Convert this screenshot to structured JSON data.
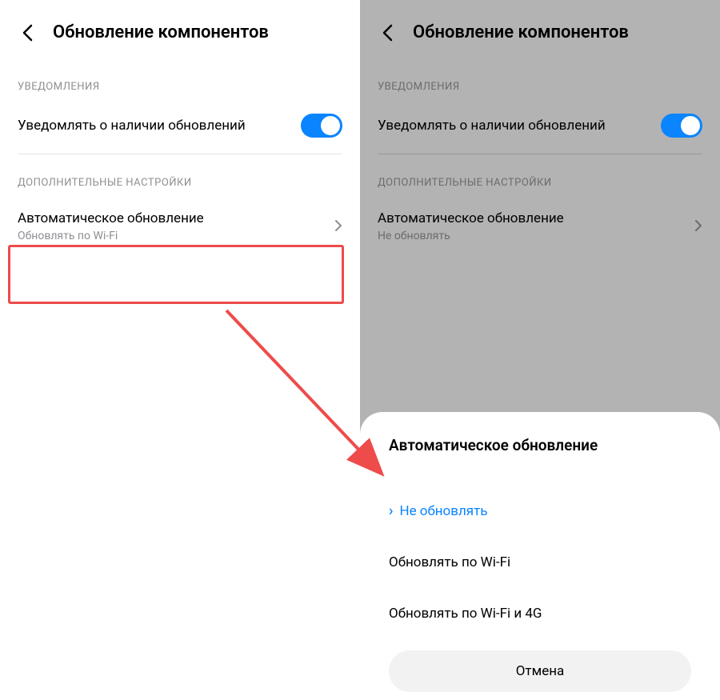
{
  "left_screen": {
    "header_title": "Обновление компонентов",
    "section_notifications": "УВЕДОМЛЕНИЯ",
    "notify_updates_title": "Уведомлять о наличии обновлений",
    "section_additional": "ДОПОЛНИТЕЛЬНЫЕ НАСТРОЙКИ",
    "auto_update_title": "Автоматическое обновление",
    "auto_update_subtitle": "Обновлять по Wi-Fi"
  },
  "right_screen": {
    "header_title": "Обновление компонентов",
    "section_notifications": "УВЕДОМЛЕНИЯ",
    "notify_updates_title": "Уведомлять о наличии обновлений",
    "section_additional": "ДОПОЛНИТЕЛЬНЫЕ НАСТРОЙКИ",
    "auto_update_title": "Автоматическое обновление",
    "auto_update_subtitle": "Не обновлять"
  },
  "bottom_sheet": {
    "title": "Автоматическое обновление",
    "option_none": "Не обновлять",
    "option_wifi": "Обновлять по Wi-Fi",
    "option_wifi_4g": "Обновлять по Wi-Fi и 4G",
    "cancel": "Отмена"
  },
  "colors": {
    "accent": "#0a84ff",
    "highlight": "#ee4b4b",
    "section_text": "#8e8e93",
    "overlay": "#b3b3b3"
  }
}
